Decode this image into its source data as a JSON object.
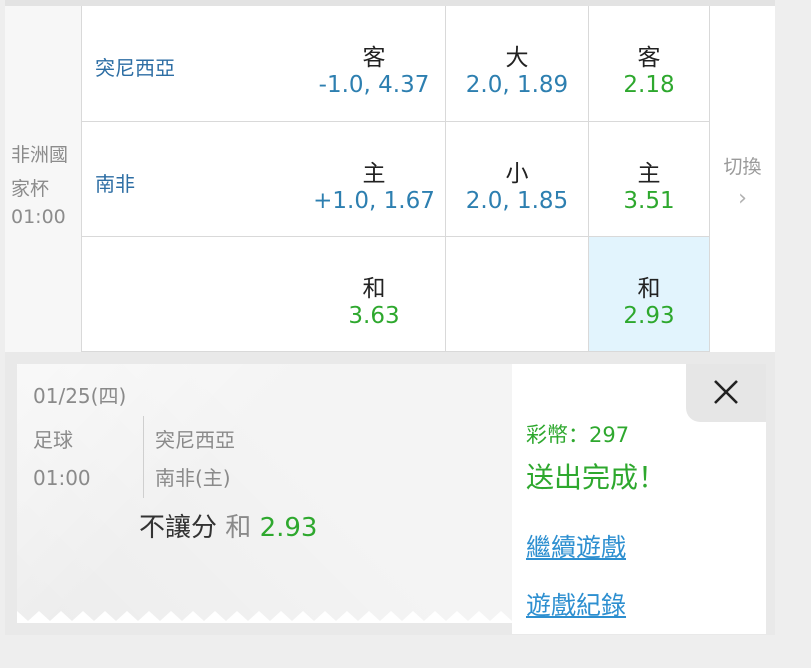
{
  "league": {
    "name": "非洲國家杯",
    "time": "01:00"
  },
  "rows": [
    {
      "team": "突尼西亞",
      "handicap": {
        "label": "客",
        "value": "-1.0, 4.37"
      },
      "overunder": {
        "label": "大",
        "value": "2.0, 1.89"
      },
      "moneyline": {
        "label": "客",
        "value": "2.18"
      }
    },
    {
      "team": "南非",
      "handicap": {
        "label": "主",
        "value": "+1.0, 1.67"
      },
      "overunder": {
        "label": "小",
        "value": "2.0, 1.85"
      },
      "moneyline": {
        "label": "主",
        "value": "3.51"
      }
    },
    {
      "team": "",
      "handicap": {
        "label": "和",
        "value": "3.63"
      },
      "moneyline": {
        "label": "和",
        "value": "2.93"
      }
    }
  ],
  "switch": {
    "label": "切換",
    "chevron": "›"
  },
  "slip": {
    "date": "01/25(四)",
    "sport": "足球",
    "time": "01:00",
    "team1": "突尼西亞",
    "team2": "南非(主)",
    "bet_type": "不讓分",
    "selection": "和",
    "odds": "2.93"
  },
  "result": {
    "coins": "彩幣：297",
    "sent": "送出完成！",
    "continue_link": "繼續遊戲",
    "history_link": "遊戲紀錄"
  },
  "icons": {
    "close": "close-icon",
    "chevron": "chevron-right-icon"
  },
  "colors": {
    "odds_blue": "#2d7fb0",
    "odds_green": "#2ea82e",
    "team_blue": "#2d6ea4",
    "selected_bg": "#e2f4fd",
    "link_blue": "#2d8fd0"
  }
}
